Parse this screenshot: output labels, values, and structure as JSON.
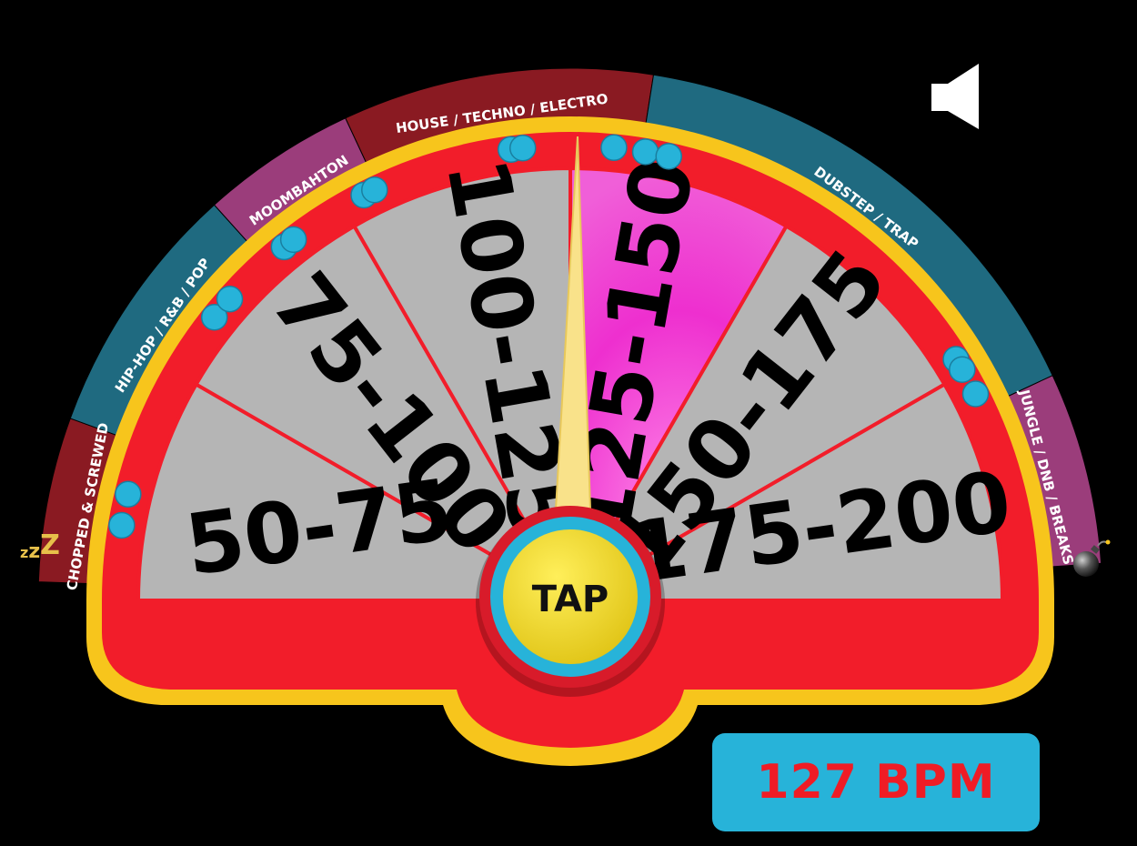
{
  "tempo_segments": [
    {
      "label": "50-75",
      "highlighted": false
    },
    {
      "label": "75-100",
      "highlighted": false
    },
    {
      "label": "100-125",
      "highlighted": false
    },
    {
      "label": "125-150",
      "highlighted": true
    },
    {
      "label": "150-175",
      "highlighted": false
    },
    {
      "label": "175-200",
      "highlighted": false
    }
  ],
  "genres": [
    {
      "label": "CHOPPED & SCREWED",
      "color": "#8a1a22"
    },
    {
      "label": "HIP-HOP / R&B / POP",
      "color": "#1f6a80"
    },
    {
      "label": "MOOMBAHTON",
      "color": "#9b3d7b"
    },
    {
      "label": "HOUSE / TECHNO / ELECTRO",
      "color": "#8a1a22"
    },
    {
      "label": "DUBSTEP / TRAP",
      "color": "#1f6a80"
    },
    {
      "label": "JUNGLE / DNB / BREAKS",
      "color": "#9b3d7b"
    }
  ],
  "tap_button": {
    "label": "TAP"
  },
  "bpm_display": {
    "value": 127,
    "text": "127 BPM"
  },
  "slow_icon": {
    "icon": "sleep-zzz-icon",
    "text": "zzZ"
  },
  "fast_icon": {
    "icon": "bomb-icon"
  },
  "sound_button": {
    "icon": "speaker-icon"
  },
  "colors": {
    "gauge_red": "#f21d2a",
    "rim_yellow": "#f7c51c",
    "segment_gray": "#b5b5b5",
    "highlight_pink": "#ee2fcf",
    "dot_blue": "#27b3d9",
    "needle": "#f9e28a",
    "bpm_text": "#ef1c25"
  }
}
